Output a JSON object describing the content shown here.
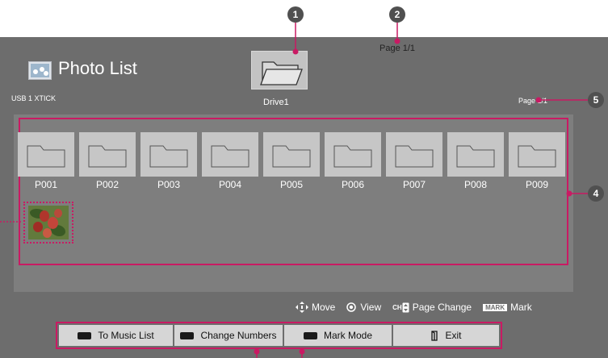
{
  "header": {
    "title": "Photo List",
    "device": "USB 1 XTICK",
    "drive_label": "Drive1",
    "page_top": "Page 1/1",
    "page_right": "Page 1/1"
  },
  "folders": [
    {
      "label": "P001"
    },
    {
      "label": "P002"
    },
    {
      "label": "P003"
    },
    {
      "label": "P004"
    },
    {
      "label": "P005"
    },
    {
      "label": "P006"
    },
    {
      "label": "P007"
    },
    {
      "label": "P008"
    },
    {
      "label": "P009"
    }
  ],
  "hints": {
    "move": "Move",
    "view": "View",
    "ch": "CH",
    "page_change": "Page Change",
    "mark_tag": "MARK",
    "mark": "Mark"
  },
  "buttons": {
    "music": "To Music List",
    "numbers": "Change Numbers",
    "mark_mode": "Mark Mode",
    "exit": "Exit"
  },
  "callouts": [
    "1",
    "2",
    "4",
    "5"
  ],
  "colors": {
    "accent": "#c91a63",
    "screen_bg": "#6d6d6d",
    "tile_bg": "#c6c6c6"
  }
}
